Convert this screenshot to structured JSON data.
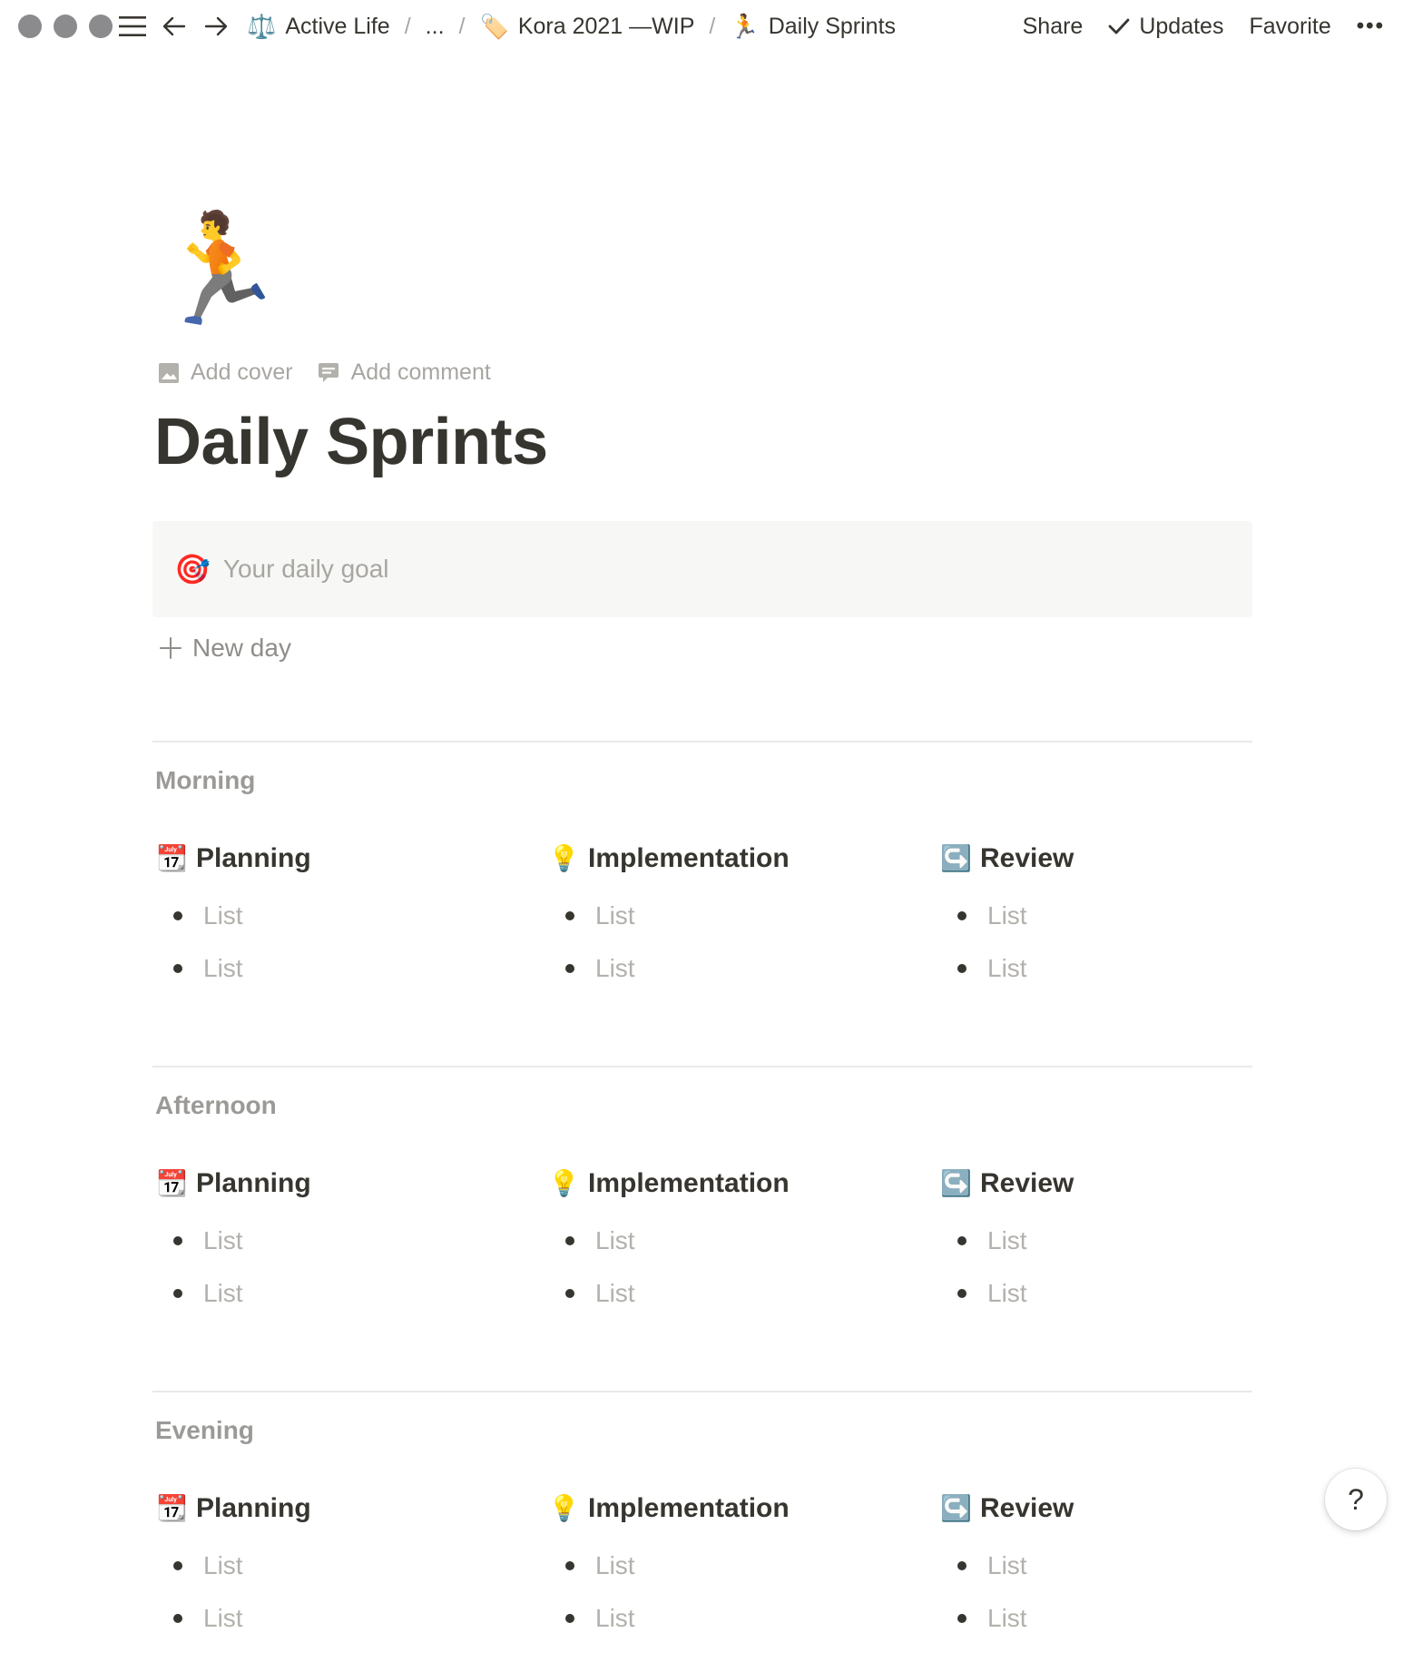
{
  "topbar": {
    "breadcrumbs": [
      {
        "emoji": "⚖️",
        "label": "Active Life"
      },
      {
        "emoji": "",
        "label": "..."
      },
      {
        "emoji": "🏷️",
        "label": "Kora 2021 —WIP"
      },
      {
        "emoji": "🏃",
        "label": "Daily Sprints"
      }
    ],
    "separator": "/",
    "actions": {
      "share": "Share",
      "updates": "Updates",
      "favorite": "Favorite",
      "more": "•••"
    }
  },
  "page": {
    "icon": "🏃",
    "add_cover": "Add cover",
    "add_comment": "Add comment",
    "title": "Daily Sprints",
    "callout": {
      "emoji": "🎯",
      "placeholder": "Your daily goal"
    },
    "new_day": "New day",
    "new_day_plus": "+"
  },
  "sections": [
    {
      "heading": "Morning",
      "columns": [
        {
          "emoji": "📆",
          "title": "Planning",
          "items": [
            "List",
            "List"
          ]
        },
        {
          "emoji": "💡",
          "title": "Implementation",
          "items": [
            "List",
            "List"
          ]
        },
        {
          "emoji": "↪️",
          "title": "Review",
          "items": [
            "List",
            "List"
          ]
        }
      ]
    },
    {
      "heading": "Afternoon",
      "columns": [
        {
          "emoji": "📆",
          "title": "Planning",
          "items": [
            "List",
            "List"
          ]
        },
        {
          "emoji": "💡",
          "title": "Implementation",
          "items": [
            "List",
            "List"
          ]
        },
        {
          "emoji": "↪️",
          "title": "Review",
          "items": [
            "List",
            "List"
          ]
        }
      ]
    },
    {
      "heading": "Evening",
      "columns": [
        {
          "emoji": "📆",
          "title": "Planning",
          "items": [
            "List",
            "List"
          ]
        },
        {
          "emoji": "💡",
          "title": "Implementation",
          "items": [
            "List",
            "List"
          ]
        },
        {
          "emoji": "↪️",
          "title": "Review",
          "items": [
            "List",
            "List"
          ]
        }
      ]
    }
  ],
  "help": "?"
}
